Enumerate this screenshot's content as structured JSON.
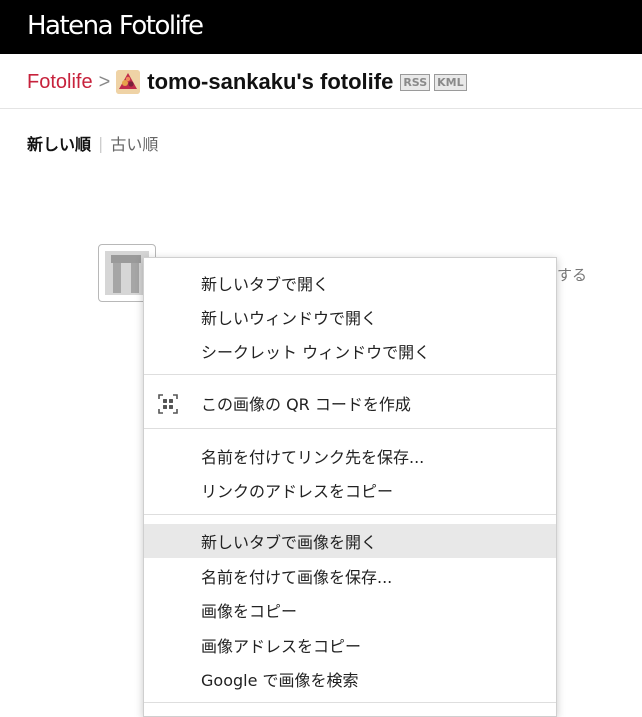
{
  "header": {
    "logo_text": "Hatena Fotolife"
  },
  "breadcrumb": {
    "root_link": "Fotolife",
    "separator": ">",
    "title": "tomo-sankaku's fotolife",
    "rss_badge": "RSS",
    "kml_badge": "KML"
  },
  "sort": {
    "active": "新しい順",
    "separator": "|",
    "other": "古い順"
  },
  "background": {
    "partial_text": "する"
  },
  "context_menu": {
    "items": [
      {
        "label": "新しいタブで開く"
      },
      {
        "label": "新しいウィンドウで開く"
      },
      {
        "label": "シークレット ウィンドウで開く"
      },
      {
        "label": "この画像の QR コードを作成",
        "icon": "qr-code-icon"
      },
      {
        "label": "名前を付けてリンク先を保存..."
      },
      {
        "label": "リンクのアドレスをコピー"
      },
      {
        "label": "新しいタブで画像を開く",
        "highlighted": true
      },
      {
        "label": "名前を付けて画像を保存..."
      },
      {
        "label": "画像をコピー"
      },
      {
        "label": "画像アドレスをコピー"
      },
      {
        "label": "Google で画像を検索"
      }
    ]
  },
  "colors": {
    "header_bg": "#000000",
    "link_red": "#c7223c",
    "menu_highlight": "#e8e8e8"
  }
}
